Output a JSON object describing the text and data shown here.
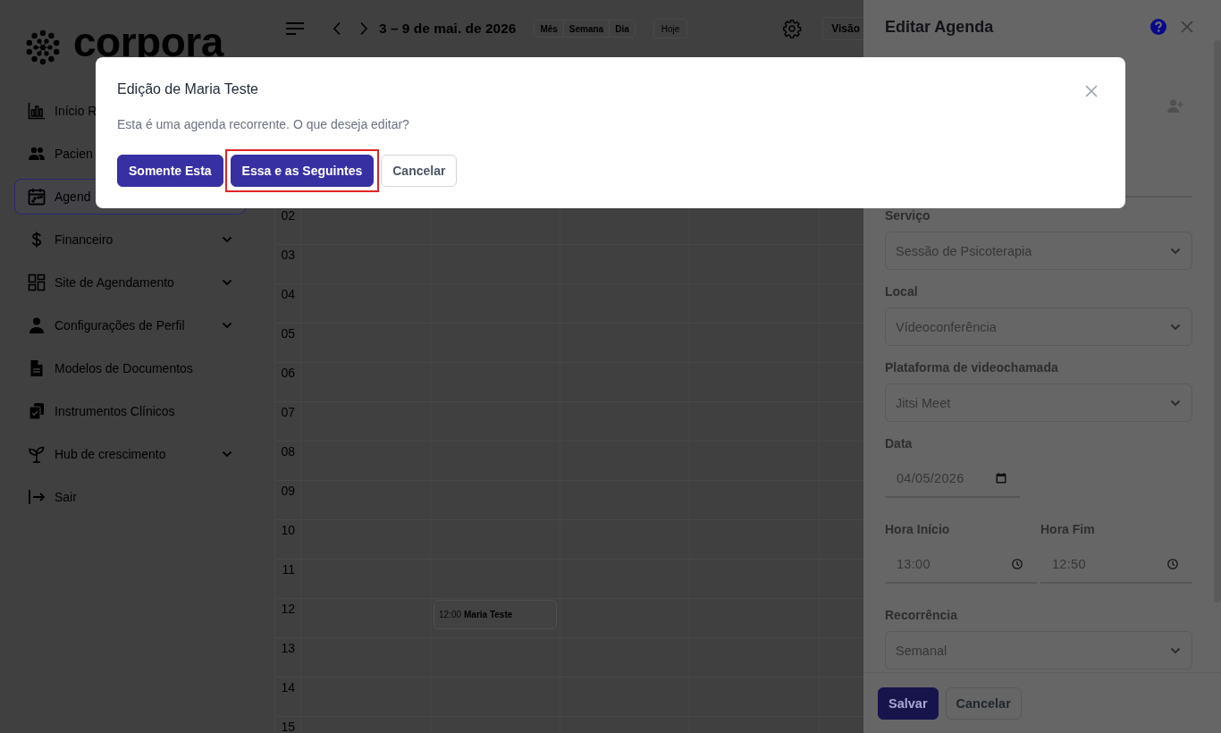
{
  "sidebar": {
    "logo": "corpora",
    "items": [
      {
        "label": "Início R",
        "kind": "link",
        "selected": false
      },
      {
        "label": "Pacien",
        "kind": "link",
        "selected": false
      },
      {
        "label": "Agend",
        "kind": "link",
        "selected": true
      },
      {
        "label": "Financeiro",
        "kind": "group",
        "selected": false
      },
      {
        "label": "Site de Agendamento",
        "kind": "group",
        "selected": false
      },
      {
        "label": "Configurações de Perfil",
        "kind": "group",
        "selected": false
      },
      {
        "label": "Modelos de Documentos",
        "kind": "link",
        "selected": false
      },
      {
        "label": "Instrumentos Clínicos",
        "kind": "link",
        "selected": false
      },
      {
        "label": "Hub de crescimento",
        "kind": "group",
        "selected": false
      },
      {
        "label": "Sair",
        "kind": "link",
        "selected": false
      }
    ]
  },
  "toolbar": {
    "date_range": "3 – 9 de mai. de 2026",
    "views": [
      {
        "label": "Mês"
      },
      {
        "label": "Semana"
      },
      {
        "label": "Dia"
      }
    ],
    "today": "Hoje",
    "view_menu": "Visão"
  },
  "calendar": {
    "hours": [
      {
        "label": "02"
      },
      {
        "label": "03"
      },
      {
        "label": "04"
      },
      {
        "label": "05"
      },
      {
        "label": "06"
      },
      {
        "label": "07"
      },
      {
        "label": "08"
      },
      {
        "label": "09"
      },
      {
        "label": "10"
      },
      {
        "label": "11"
      },
      {
        "label": "12",
        "events": [
          {
            "time": "12:00",
            "title": "Maria Teste"
          }
        ]
      },
      {
        "label": "13"
      },
      {
        "label": "14"
      },
      {
        "label": "15"
      }
    ]
  },
  "drawer": {
    "title": "Editar Agenda",
    "fields": [
      {
        "kind": "person"
      },
      {
        "kind": "select",
        "label": "Serviço",
        "value": "Sessão de Psicoterapia"
      },
      {
        "kind": "select",
        "label": "Local",
        "value": "Vídeoconferência"
      },
      {
        "kind": "select",
        "label": "Plataforma de videochamada",
        "value": "Jitsi Meet"
      },
      {
        "kind": "date",
        "label": "Data",
        "value": "04/05/2026"
      },
      {
        "kind": "time_pair",
        "items": [
          {
            "label": "Hora Início",
            "value": "13:00"
          },
          {
            "label": "Hora Fim",
            "value": "12:50"
          }
        ]
      },
      {
        "kind": "select",
        "label": "Recorrência",
        "value": "Semanal"
      }
    ],
    "buttons": [
      {
        "label": "Salvar",
        "kind": "primary"
      },
      {
        "label": "Cancelar",
        "kind": "secondary"
      }
    ]
  },
  "dialog": {
    "title": "Edição de Maria Teste",
    "message": "Esta é uma agenda recorrente. O que deseja editar?",
    "buttons": [
      {
        "label": "Somente Esta",
        "kind": "primary",
        "highlighted": false
      },
      {
        "label": "Essa e as Seguintes",
        "kind": "primary",
        "highlighted": true
      },
      {
        "label": "Cancelar",
        "kind": "secondary",
        "highlighted": false
      }
    ]
  }
}
